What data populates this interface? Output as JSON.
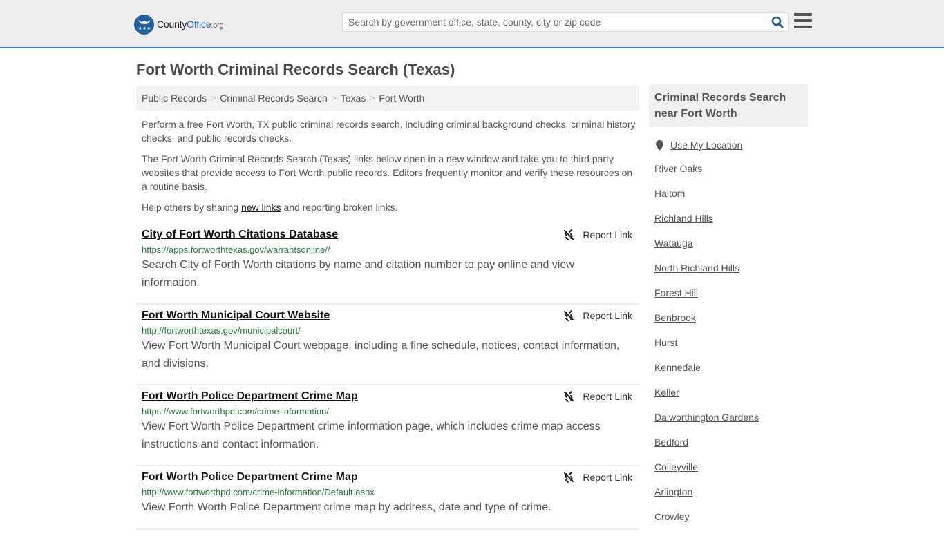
{
  "header": {
    "logo": {
      "county": "County",
      "office": "Office",
      "org": ".org"
    },
    "search_placeholder": "Search by government office, state, county, city or zip code",
    "search_value": "",
    "brand_color": "#1d63b0",
    "accent_line_color": "#3b7dad"
  },
  "page": {
    "title": "Fort Worth Criminal Records Search (Texas)"
  },
  "breadcrumb": [
    {
      "label": "Public Records"
    },
    {
      "label": "Criminal Records Search"
    },
    {
      "label": "Texas"
    },
    {
      "label": "Fort Worth"
    }
  ],
  "intro": {
    "p1": "Perform a free Fort Worth, TX public criminal records search, including criminal background checks, criminal history checks, and public records checks.",
    "p2": "The Fort Worth Criminal Records Search (Texas) links below open in a new window and take you to third party websites that provide access to Fort Worth public records. Editors frequently monitor and verify these resources on a routine basis.",
    "p3_before": "Help others by sharing ",
    "p3_link": "new links",
    "p3_after": " and reporting broken links."
  },
  "results": [
    {
      "title": "City of Fort Worth Citations Database",
      "url": "https://apps.fortworthtexas.gov/warrantsonline//",
      "description": "Search City of Forth Worth citations by name and citation number to pay online and view information.",
      "report_label": "Report Link"
    },
    {
      "title": "Fort Worth Municipal Court Website",
      "url": "http://fortworthtexas.gov/municipalcourt/",
      "description": "View Fort Worth Municipal Court webpage, including a fine schedule, notices, contact information, and divisions.",
      "report_label": "Report Link"
    },
    {
      "title": "Fort Worth Police Department Crime Map",
      "url": "https://www.fortworthpd.com/crime-information/",
      "description": "View Fort Worth Police Department crime information page, which includes crime map access instructions and contact information.",
      "report_label": "Report Link"
    },
    {
      "title": "Fort Worth Police Department Crime Map",
      "url": "http://www.fortworthpd.com/crime-information/Default.aspx",
      "description": "View Forth Worth Police Department crime map by address, date and type of crime.",
      "report_label": "Report Link"
    }
  ],
  "sidebar": {
    "heading": "Criminal Records Search near Fort Worth",
    "use_location": "Use My Location",
    "nearby": [
      "River Oaks",
      "Haltom",
      "Richland Hills",
      "Watauga",
      "North Richland Hills",
      "Forest Hill",
      "Benbrook",
      "Hurst",
      "Kennedale",
      "Keller",
      "Dalworthington Gardens",
      "Bedford",
      "Colleyville",
      "Arlington",
      "Crowley"
    ]
  }
}
